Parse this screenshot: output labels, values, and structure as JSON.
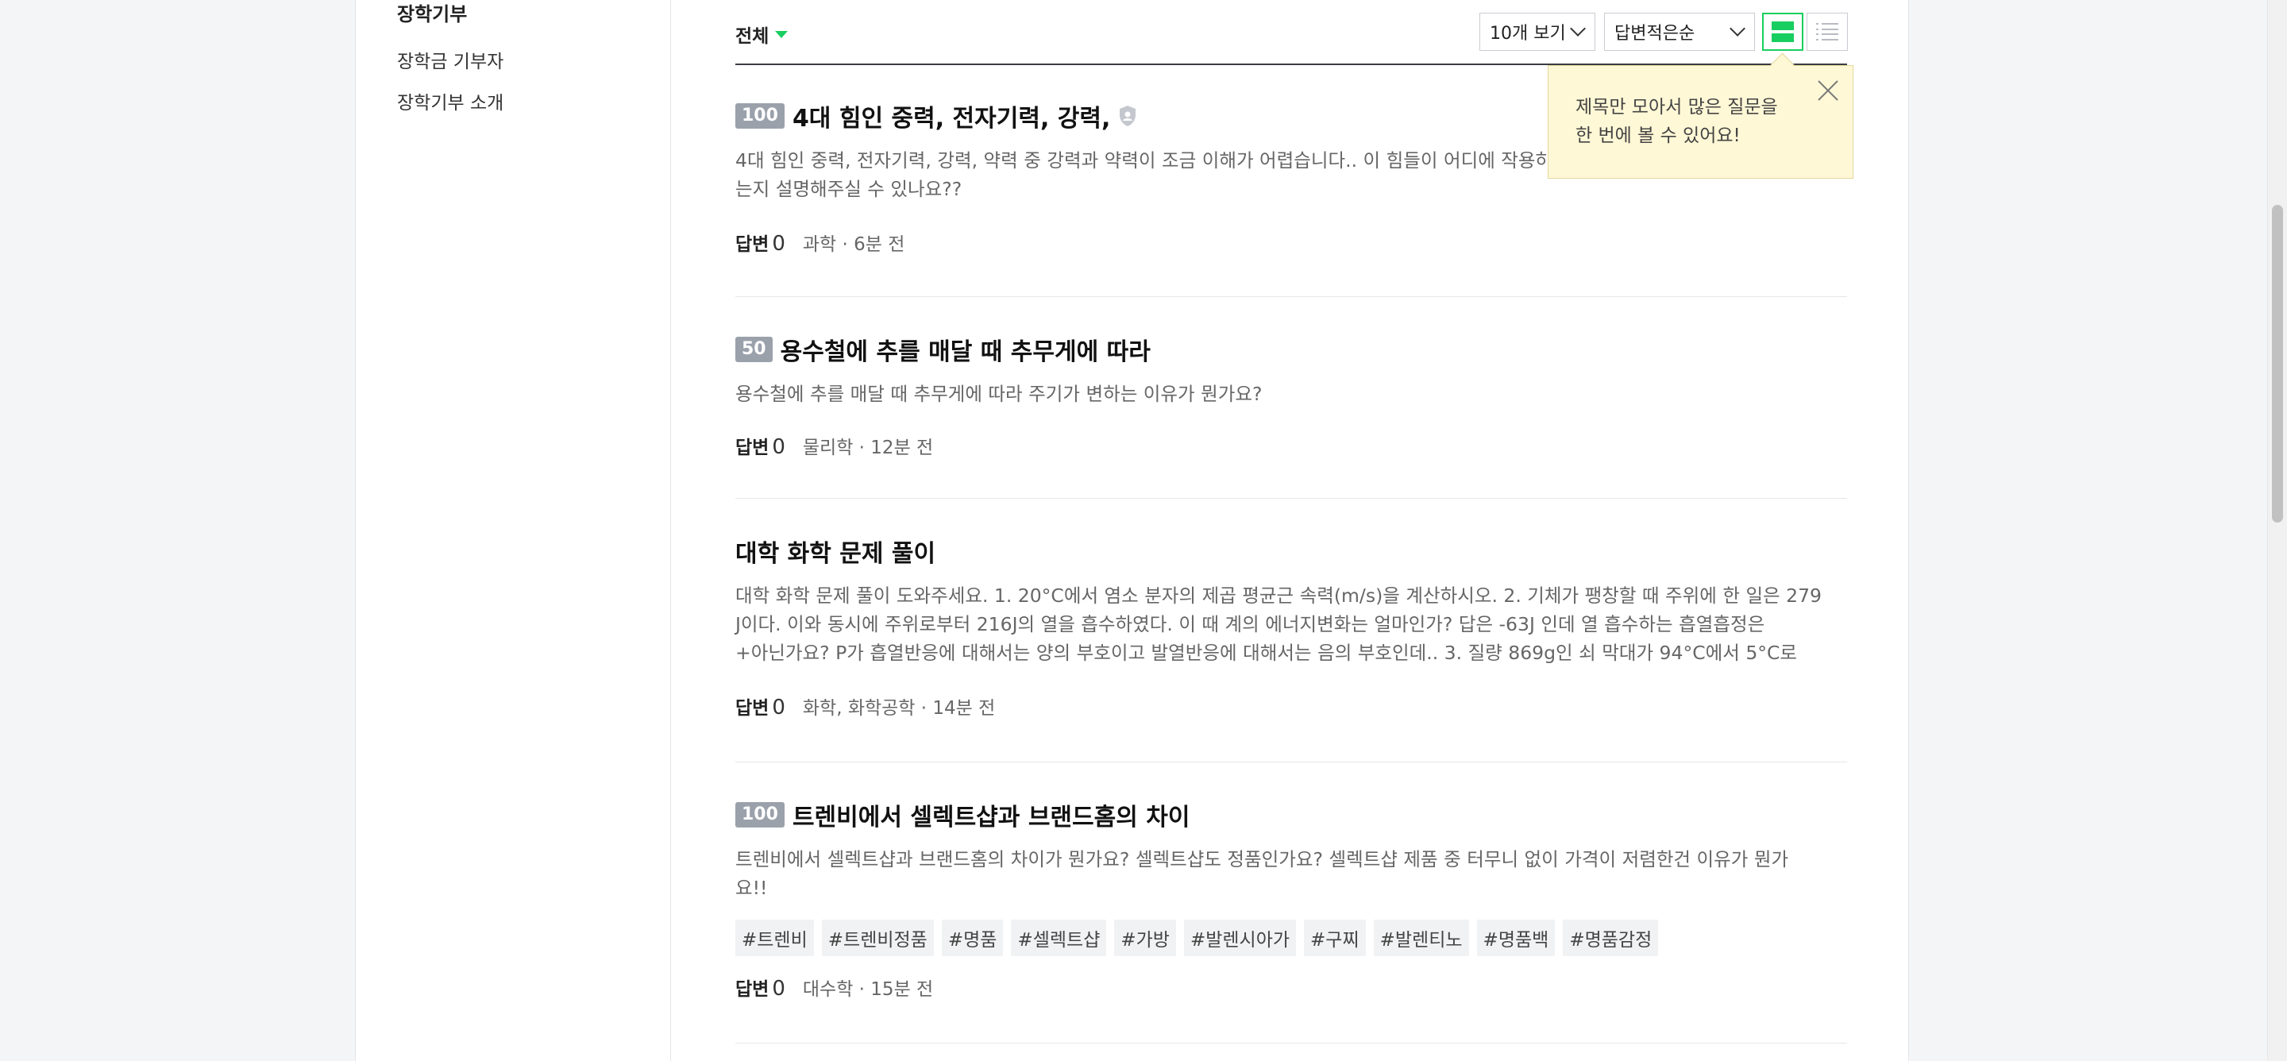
{
  "sidebar": {
    "title": "장학기부",
    "links": [
      "장학금 기부자",
      "장학기부 소개"
    ]
  },
  "toolbar": {
    "filter_label": "전체",
    "page_size": "10개 보기",
    "sort": "답변적은순"
  },
  "tooltip": {
    "line1": "제목만 모아서 많은 질문을",
    "line2": "한 번에 볼 수 있어요!"
  },
  "colors": {
    "accent": "#19ce60",
    "badge": "#9aa1ab",
    "tooltip_bg": "#fff8d6"
  },
  "questions": [
    {
      "points": "100",
      "title": "4대 힘인 중력, 전자기력, 강력,",
      "body": "4대 힘인 중력, 전자기력, 강력, 약력 중 강력과 약력이 조금 이해가 어렵습니다.. 이 힘들이 어디에 작용하",
      "body2": "는지 설명해주실 수 있나요??",
      "answer_label": "답변",
      "answer_count": "0",
      "category": "과학",
      "time": "6분 전"
    },
    {
      "points": "50",
      "title": "용수철에 추를 매달 때 추무게에 따라",
      "body": "용수철에 추를 매달 때 추무게에 따라 주기가 변하는 이유가 뭔가요?",
      "answer_label": "답변",
      "answer_count": "0",
      "category": "물리학",
      "time": "12분 전"
    },
    {
      "points": "",
      "title": "대학 화학 문제 풀이",
      "body": "대학 화학 문제 풀이 도와주세요. 1. 20°C에서 염소 분자의 제곱 평균근 속력(m/s)을 계산하시오. 2. 기체가 팽창할 때 주위에 한 일은 279",
      "body2": "J이다. 이와 동시에 주위로부터 216J의 열을 흡수하였다. 이 때 계의 에너지변화는 얼마인가? 답은 -63J 인데 열 흡수하는 흡열흡정은",
      "body3": "+아닌가요? P가 흡열반응에 대해서는 양의 부호이고 발열반응에 대해서는 음의 부호인데.. 3. 질량 869g인 쇠 막대가 94°C에서 5°C로",
      "answer_label": "답변",
      "answer_count": "0",
      "category": "화학, 화학공학",
      "time": "14분 전"
    },
    {
      "points": "100",
      "title": "트렌비에서 셀렉트샵과 브랜드홈의 차이",
      "body": "트렌비에서 셀렉트샵과 브랜드홈의 차이가 뭔가요? 셀렉트샵도 정품인가요? 셀렉트샵 제품 중 터무니 없이 가격이 저렴한건 이유가 뭔가",
      "body2": "요!!",
      "tags": [
        "#트렌비",
        "#트렌비정품",
        "#명품",
        "#셀렉트샵",
        "#가방",
        "#발렌시아가",
        "#구찌",
        "#발렌티노",
        "#명품백",
        "#명품감정"
      ],
      "answer_label": "답변",
      "answer_count": "0",
      "category": "대수학",
      "time": "15분 전"
    }
  ]
}
